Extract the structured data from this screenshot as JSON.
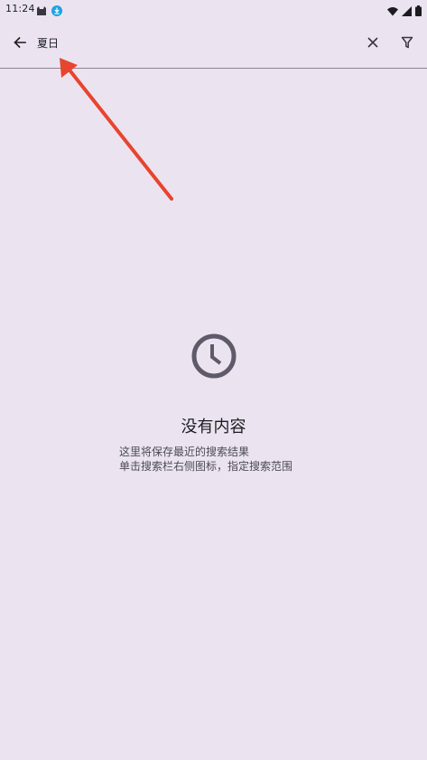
{
  "status_bar": {
    "time": "11:24",
    "icons": [
      "cat-icon",
      "download-icon",
      "wifi-icon",
      "signal-icon",
      "battery-icon"
    ]
  },
  "search_bar": {
    "query": "夏日",
    "icons": {
      "back": "arrow-left-icon",
      "clear": "close-icon",
      "filter": "filter-icon"
    }
  },
  "empty_state": {
    "icon": "clock-icon",
    "title": "没有内容",
    "line1": "这里将保存最近的搜索结果",
    "line2": "单击搜索栏右侧图标，指定搜索范围"
  },
  "colors": {
    "background": "#ebe4f0",
    "icon": "#5f5969",
    "annotation_arrow": "#e8442f",
    "divider": "#8a8590"
  }
}
